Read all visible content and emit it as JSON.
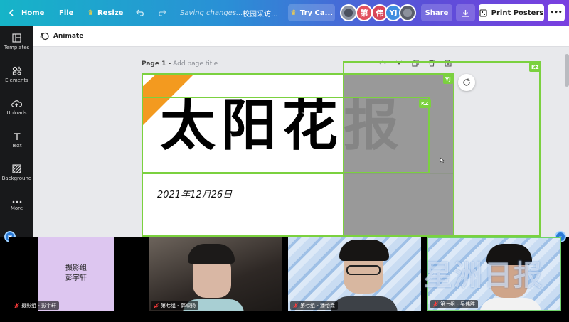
{
  "topbar": {
    "home": "Home",
    "file": "File",
    "resize": "Resize",
    "saving": "Saving changes...",
    "doc_title": "校园采访...",
    "try": "Try Ca...",
    "avatars": [
      "第",
      "伟",
      "YJ"
    ],
    "share": "Share",
    "print": "Print Posters",
    "more": "•••"
  },
  "rail": {
    "items": [
      {
        "label": "Templates",
        "icon": "templates-icon"
      },
      {
        "label": "Elements",
        "icon": "elements-icon"
      },
      {
        "label": "Uploads",
        "icon": "uploads-icon"
      },
      {
        "label": "Text",
        "icon": "text-icon"
      },
      {
        "label": "Background",
        "icon": "background-icon"
      },
      {
        "label": "More",
        "icon": "more-icon"
      }
    ]
  },
  "editor": {
    "animate": "Animate",
    "page_label": "Page 1 -",
    "page_title_placeholder": "Add page title",
    "headline": "太阳花报",
    "date": "2021年12月26日",
    "sel_tags": [
      "KZ",
      "YJ",
      "KZ"
    ]
  },
  "colors": {
    "accent_green": "#7bd13f",
    "orange": "#f39a1f"
  },
  "participants": [
    {
      "name": "摄影组 - 彭宇轩",
      "tile_text_1": "摄影组",
      "tile_text_2": "彭宇轩"
    },
    {
      "name": "第七组 - 郭顺扬"
    },
    {
      "name": "第七组 - 潘怡霖"
    },
    {
      "name": "第七组 - 吴伟胜"
    }
  ],
  "watermark": "星洲日报"
}
